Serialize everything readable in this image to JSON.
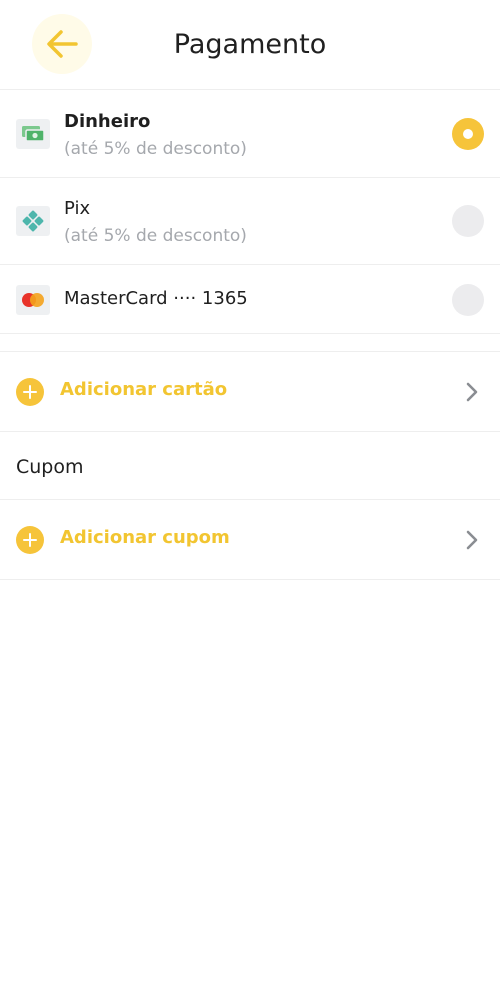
{
  "header": {
    "title": "Pagamento",
    "back_icon": "arrow-left-icon"
  },
  "payment_methods": [
    {
      "title": "Dinheiro",
      "subtitle": "(até 5% de desconto)",
      "icon": "cash-icon",
      "selected": true
    },
    {
      "title": "Pix",
      "subtitle": "(até 5% de desconto)",
      "icon": "pix-icon",
      "selected": false
    },
    {
      "title": "MasterCard ···· 1365",
      "icon": "mastercard-icon",
      "selected": false
    }
  ],
  "add_card": {
    "label": "Adicionar cartão"
  },
  "coupon": {
    "section_title": "Cupom",
    "add_label": "Adicionar cupom"
  },
  "colors": {
    "accent": "#f6c43a",
    "accent_text": "#f2c531",
    "muted_text": "#a5a8ad",
    "radio_off": "#ececee"
  }
}
